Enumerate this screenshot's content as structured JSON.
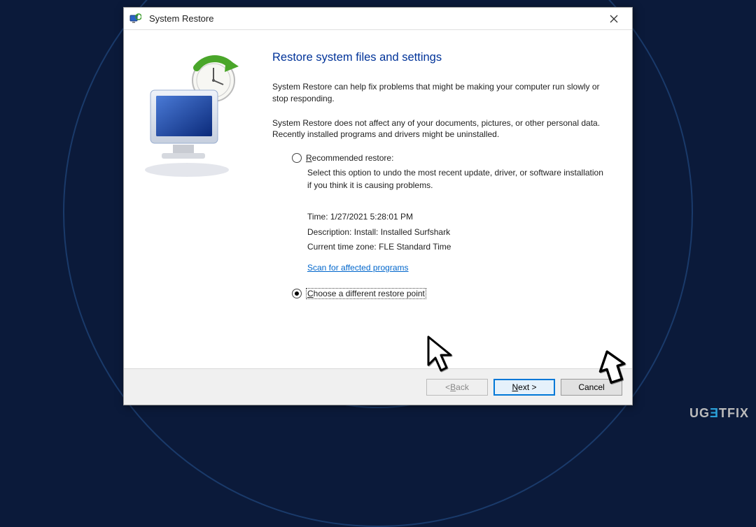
{
  "window": {
    "title": "System Restore"
  },
  "main": {
    "heading": "Restore system files and settings",
    "intro1": "System Restore can help fix problems that might be making your computer run slowly or stop responding.",
    "intro2": "System Restore does not affect any of your documents, pictures, or other personal data. Recently installed programs and drivers might be uninstalled."
  },
  "recommended": {
    "label_prefix": "R",
    "label_rest": "ecommended restore:",
    "desc": "Select this option to undo the most recent update, driver, or software installation if you think it is causing problems.",
    "time_label": "Time:",
    "time_value": "1/27/2021 5:28:01 PM",
    "desc_label": "Description:",
    "desc_value": "Install: Installed Surfshark",
    "tz_label": "Current time zone:",
    "tz_value": "FLE Standard Time",
    "scan_link": "Scan for affected programs"
  },
  "different": {
    "label_prefix": "C",
    "label_rest": "hoose a different restore point"
  },
  "footer": {
    "back": "< Back",
    "next": "Next >",
    "cancel": "Cancel"
  },
  "watermark": {
    "u": "U",
    "g": "G",
    "e": "Ǝ",
    "t": "T",
    "fix": "FIX"
  }
}
